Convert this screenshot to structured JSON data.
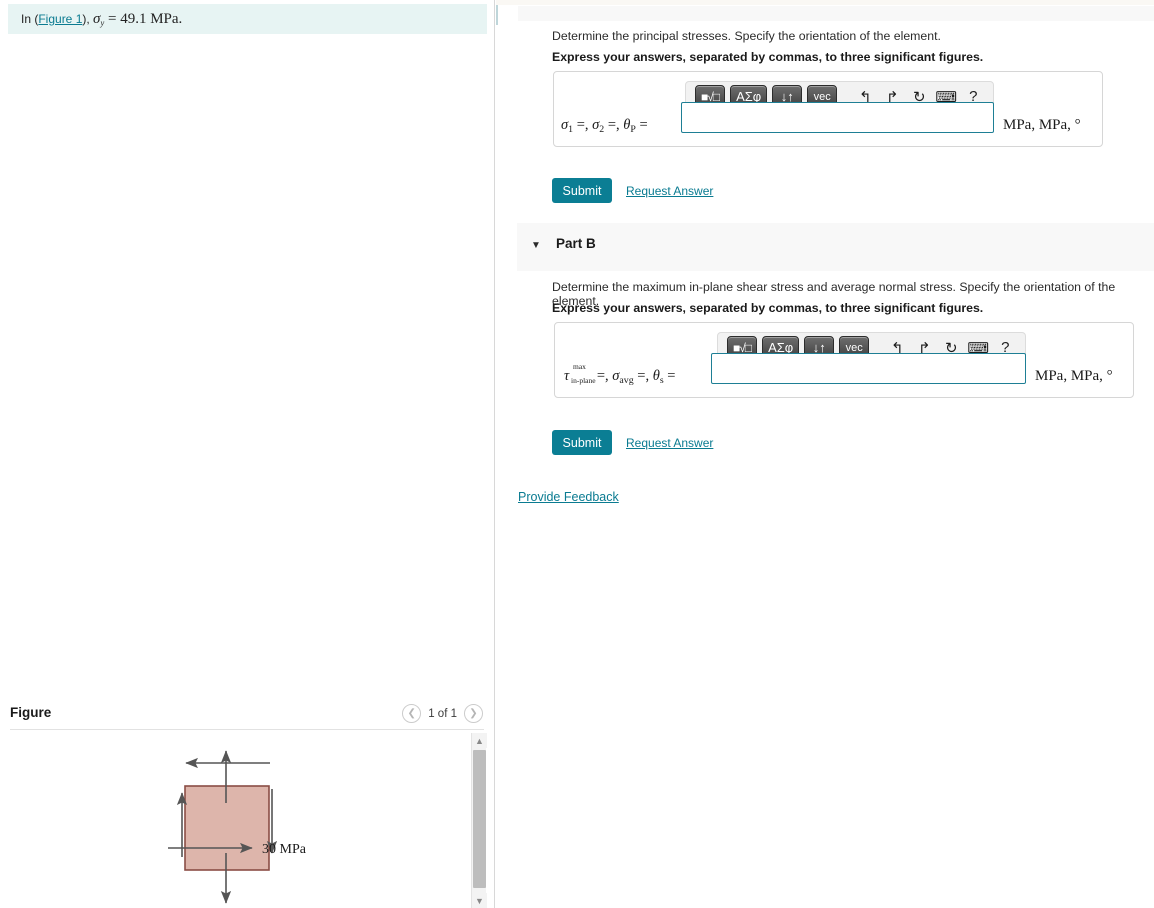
{
  "problem": {
    "prefix": "In (",
    "figure_link": "Figure 1",
    "suffix": "), ",
    "symbol": "σ",
    "symbol_sub": "y",
    "equals": " = ",
    "value": "49.1 MPa."
  },
  "toolbar": {
    "keys": [
      {
        "name": "template-key",
        "label": "■√□"
      },
      {
        "name": "greek-key",
        "label": "ΑΣφ"
      },
      {
        "name": "updown-key",
        "label": "↓↑"
      },
      {
        "name": "vec-key",
        "label": "vec"
      }
    ],
    "icons": [
      {
        "name": "undo-icon",
        "glyph": "↰"
      },
      {
        "name": "redo-icon",
        "glyph": "↱"
      },
      {
        "name": "reset-icon",
        "glyph": "↻"
      },
      {
        "name": "keyboard-icon",
        "glyph": "⌨"
      },
      {
        "name": "help-icon",
        "glyph": "?"
      }
    ]
  },
  "part_a": {
    "question": "Determine the principal stresses. Specify the orientation of the element.",
    "instruction": "Express your answers, separated by commas, to three significant figures.",
    "answer_label_sigma1": "σ",
    "answer_label_sigma1_sub": "1",
    "answer_label_sigma2": "σ",
    "answer_label_sigma2_sub": "2",
    "answer_label_theta": "θ",
    "answer_label_theta_sub": "P",
    "eq1": " =, ",
    "eq2": " =, ",
    "eq3": " = ",
    "input_value": "",
    "input_placeholder": "",
    "units": "MPa, MPa, °",
    "submit_label": "Submit",
    "request_answer_label": "Request Answer"
  },
  "part_b": {
    "header_label": "Part B",
    "question": "Determine the maximum in-plane shear stress and average normal stress. Specify the orientation of the element.",
    "instruction": "Express your answers, separated by commas, to three significant figures.",
    "answer_label_tau": "τ",
    "answer_label_tau_sup": "max",
    "answer_label_tau_sub": "in-plane",
    "answer_label_sigma_avg": "σ",
    "answer_label_sigma_avg_sub": "avg",
    "answer_label_theta": "θ",
    "answer_label_theta_sub": "s",
    "eq1": " =, ",
    "eq2": " =, ",
    "eq3": " = ",
    "input_value": "",
    "input_placeholder": "",
    "units": "MPa, MPa, °",
    "submit_label": "Submit",
    "request_answer_label": "Request Answer"
  },
  "provide_feedback_label": "Provide Feedback",
  "figure_panel": {
    "title": "Figure",
    "counter": "1 of 1",
    "prev_glyph": "❮",
    "next_glyph": "❯",
    "stress_label": "30 MPa",
    "element_fill": "#ddb5ab",
    "element_stroke": "#8a4d45",
    "arrow_color": "#555555"
  },
  "colors": {
    "accent_teal": "#0b7e94",
    "link_teal": "#0a7b91",
    "highlight_bg": "#e7f4f3",
    "panel_gray": "#f8f8f8"
  }
}
